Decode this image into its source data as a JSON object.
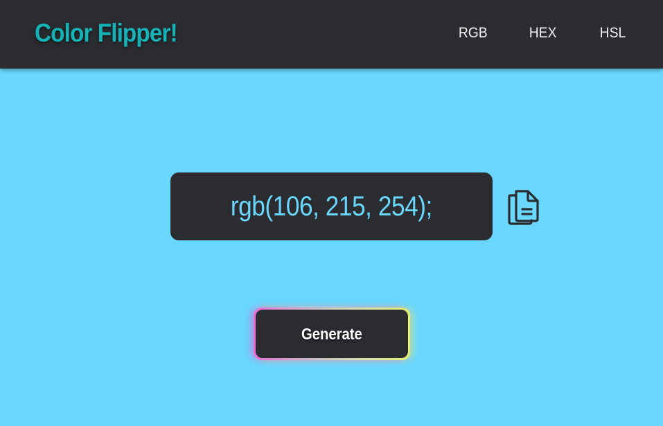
{
  "app": {
    "title": "Color Flipper!"
  },
  "nav": {
    "items": [
      {
        "label": "RGB"
      },
      {
        "label": "HEX"
      },
      {
        "label": "HSL"
      }
    ]
  },
  "display": {
    "color_value": "rgb(106, 215, 254);",
    "background_color": "#6ad7fe",
    "copy_icon": "copy-icon"
  },
  "actions": {
    "generate_label": "Generate"
  },
  "theme": {
    "panel": "#2b2c2f",
    "brand": "#15b3b8",
    "accent_gradient": [
      "#e86bd6",
      "#e6ee6f"
    ]
  }
}
